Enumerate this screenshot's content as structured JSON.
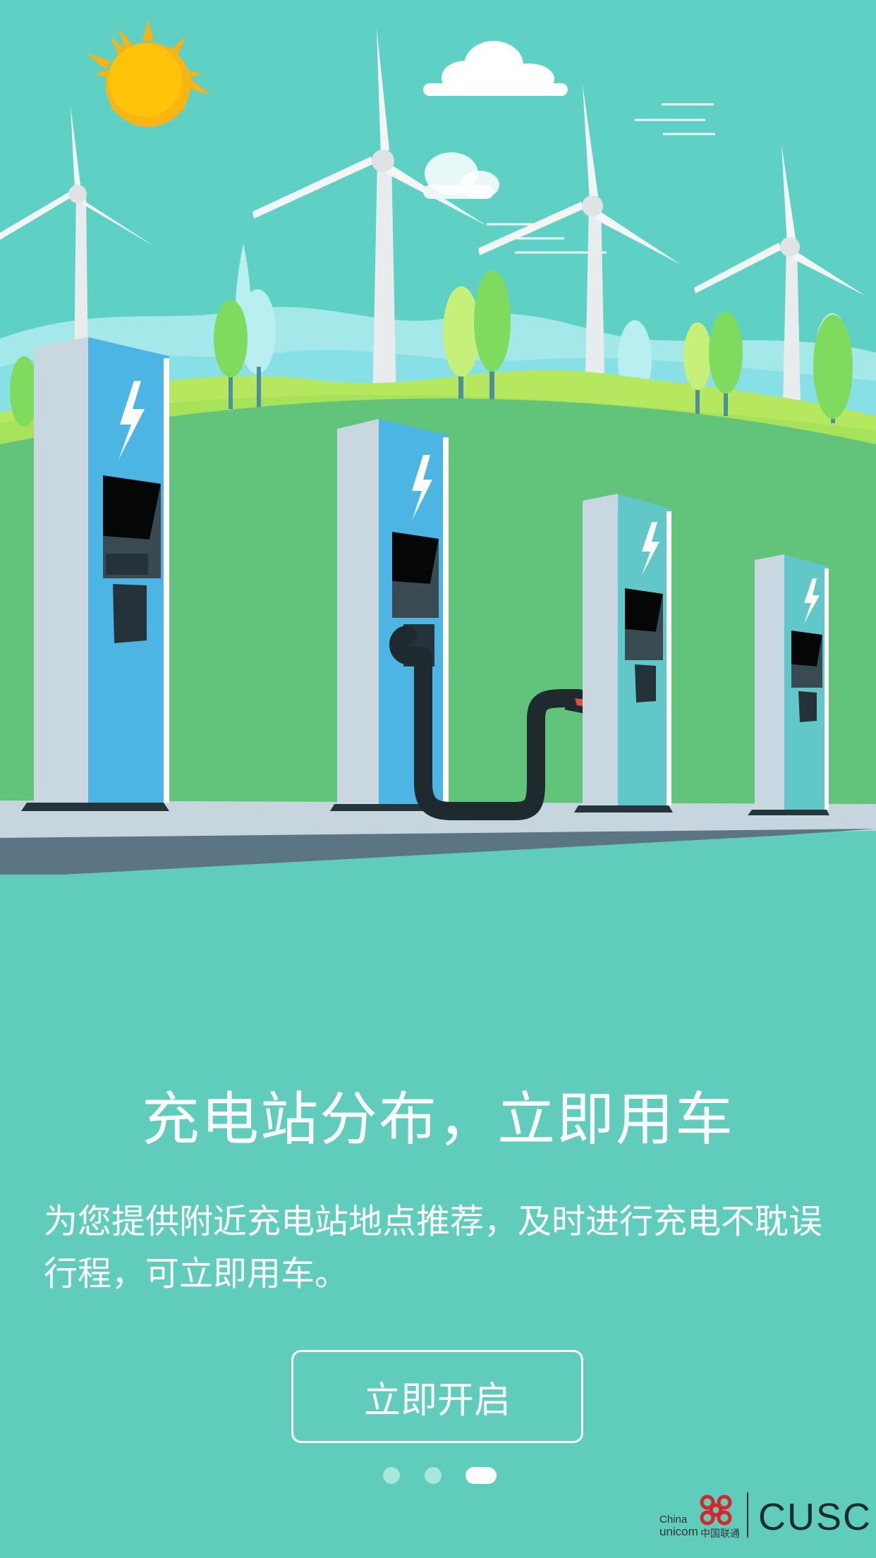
{
  "headline": "充电站分布，立即用车",
  "description": "为您提供附近充电站地点推荐，及时进行充电不耽误行程，可立即用车。",
  "start_button": "立即开启",
  "pagination": {
    "total": 3,
    "active": 3
  },
  "brand": {
    "china": "China",
    "unicom": "unicom",
    "cn": "中国联通",
    "cusc": "CUSC"
  },
  "colors": {
    "background": "#60cdbc",
    "sky": "#5fd1c4",
    "hill": "#62c47a",
    "charger_blue": "#4bb3e3",
    "charger_teal": "#62c7c8"
  }
}
